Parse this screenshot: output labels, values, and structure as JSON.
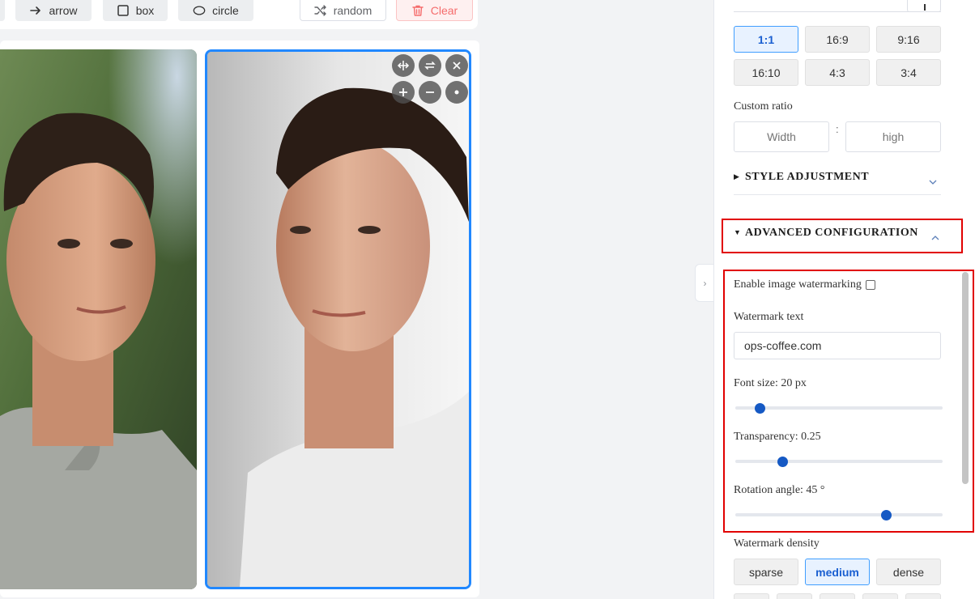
{
  "toolbar": {
    "arrow_label": "arrow",
    "box_label": "box",
    "circle_label": "circle",
    "random_label": "random",
    "clear_label": "Clear"
  },
  "ratios": [
    "1:1",
    "16:9",
    "9:16",
    "16:10",
    "4:3",
    "3:4"
  ],
  "selected_ratio": "1:1",
  "custom_ratio": {
    "label": "Custom ratio",
    "width_placeholder": "Width",
    "separator": ":",
    "height_placeholder": "high"
  },
  "sections": {
    "style_adjustment": "STYLE ADJUSTMENT",
    "advanced_configuration": "ADVANCED CONFIGURATION"
  },
  "watermark": {
    "enable_label": "Enable image watermarking",
    "text_label": "Watermark text",
    "text_value": "ops-coffee.com",
    "font_size_label": "Font size: 20 px",
    "font_size_fraction": 0.12,
    "transparency_label": "Transparency: 0.25",
    "transparency_fraction": 0.23,
    "rotation_label": "Rotation angle: 45 °",
    "rotation_fraction": 0.73,
    "density_label": "Watermark density",
    "density_options": [
      "sparse",
      "medium",
      "dense"
    ],
    "density_selected": "medium"
  },
  "colors": {
    "accent": "#409eff",
    "selected_border": "#2188ff",
    "highlight": "#e10000",
    "danger": "#f56c6c",
    "slider": "#1559c4"
  },
  "icons": {
    "arrow": "arrow-right-icon",
    "box": "square-icon",
    "circle": "ellipse-icon",
    "random": "shuffle-icon",
    "clear": "trash-icon"
  }
}
